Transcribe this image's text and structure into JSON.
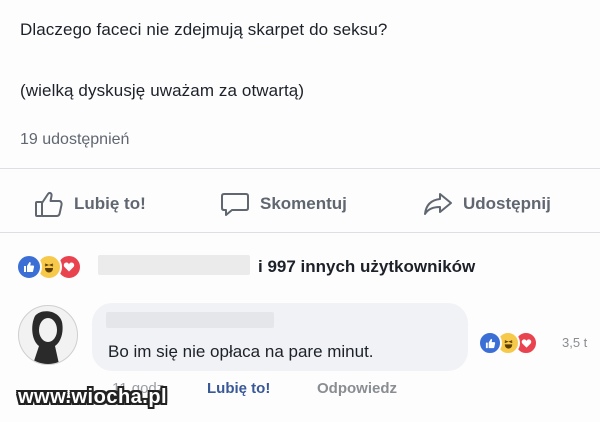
{
  "post": {
    "line1": "Dlaczego faceci nie zdejmują skarpet do seksu?",
    "line2": "(wielką dyskusję uważam za otwartą)",
    "shares": "19 udostępnień"
  },
  "actions": {
    "like": "Lubię to!",
    "comment": "Skomentuj",
    "share": "Udostępnij"
  },
  "reactions": {
    "summary": "i 997 innych użytkowników",
    "icons": [
      "like-icon",
      "haha-icon",
      "love-icon"
    ]
  },
  "comment": {
    "text": "Bo im się nie opłaca na pare minut.",
    "reaction_count": "3,5 t",
    "time": "11 godz",
    "like_label": "Lubię to!",
    "reply_label": "Odpowiedz"
  },
  "watermark": "www.wiocha.pl",
  "colors": {
    "like": "#3b6fd6",
    "haha": "#f6c94a",
    "love": "#e9434f",
    "link": "#385898",
    "muted": "#606770"
  }
}
